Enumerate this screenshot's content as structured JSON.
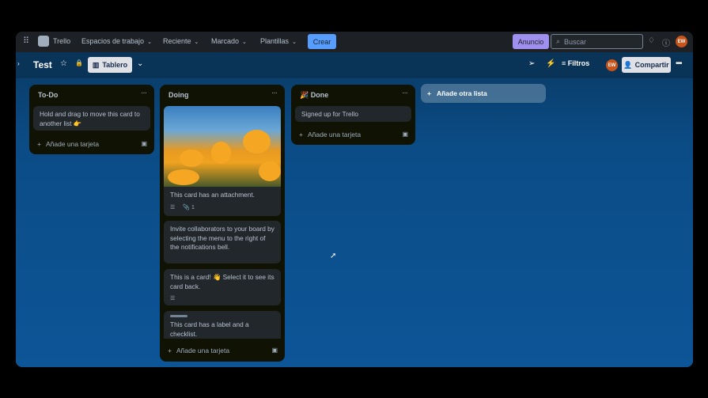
{
  "topbar": {
    "app": "Trello",
    "nav": [
      "Espacios de trabajo",
      "Reciente",
      "Marcado",
      "Plantillas"
    ],
    "create": "Crear",
    "announce": "Anuncio",
    "search_placeholder": "Buscar",
    "avatar": "EW"
  },
  "board": {
    "title": "Test",
    "view": "Tablero",
    "filters": "Filtros",
    "share": "Compartir",
    "avatar": "EW",
    "add_list": "Añade otra lista",
    "add_card": "Añade una tarjeta"
  },
  "lists": [
    {
      "title": "To-Do",
      "cards": [
        "Hold and drag to move this card to another list 👉"
      ]
    },
    {
      "title": "Doing",
      "cards": [
        "This card has an attachment.",
        "Invite collaborators to your board by selecting the menu to the right of the notifications bell.",
        "This is a card! 👋 Select it to see its card back.",
        "This card has a label and a checklist."
      ],
      "attachment_count": "1"
    },
    {
      "title": "🎉 Done",
      "cards": [
        "Signed up for Trello"
      ]
    }
  ]
}
